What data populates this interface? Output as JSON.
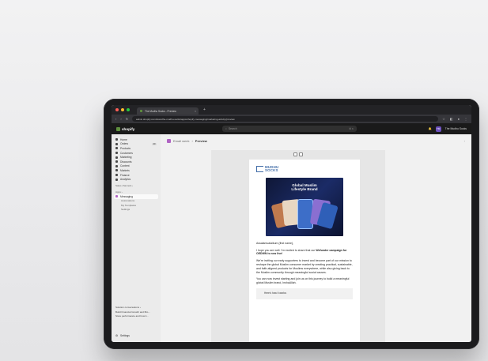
{
  "browser": {
    "tab_title": "The Mudhu Socks - Preview",
    "tab_close": "×",
    "new_tab": "+",
    "url": "admin.shopify.com/store/the-mudhu-socks/apps/shopify-messaging/marketing-activity/preview",
    "nav_back": "‹",
    "nav_forward": "›",
    "nav_reload": "↻"
  },
  "topbar": {
    "brand": "shopify",
    "search_placeholder": "Search",
    "search_shortcut": "⌘ K",
    "store_initials": "TM",
    "store_name": "The Mudhu Socks"
  },
  "sidebar": {
    "items": [
      {
        "label": "Home"
      },
      {
        "label": "Orders",
        "count": "20"
      },
      {
        "label": "Products"
      },
      {
        "label": "Customers"
      },
      {
        "label": "Marketing"
      },
      {
        "label": "Discounts"
      },
      {
        "label": "Content"
      },
      {
        "label": "Markets"
      },
      {
        "label": "Finance"
      },
      {
        "label": "Analytics"
      }
    ],
    "sales_channels": "Sales channels ›",
    "apps": "Apps ›",
    "active_app": "Messaging",
    "subitems": [
      "Automations",
      "My Templates",
      "Settings"
    ],
    "bottom": [
      "Solution conversations ›",
      "Build Financial Growth and Bro...",
      "Store performance and how it..."
    ],
    "settings": "Settings"
  },
  "main": {
    "breadcrumb_parent": "Email week",
    "breadcrumb_sep": "›",
    "breadcrumb_current": "Preview",
    "right_icon": "›"
  },
  "email": {
    "brand_line1": "MUDHU",
    "brand_line2": "SOCKS",
    "hero_title_line1": "Global Muslim",
    "hero_title_line2": "Lifestyle Brand",
    "greeting": "Assalamualaikum {first name},",
    "p1_start": "I hope you are well. I'm excited to share that our ",
    "p1_bold": "Wefunder campaign for OEDWN is now live!",
    "p2": "We're inviting our early supporters to invest and become part of our mission to reshape the global Muslim consumer market by creating practical, sustainable, and faith-aligned products for Muslims everywhere, while also giving back to the Muslim community through meaningful social causes.",
    "p3": "You can now invest starting and join us on this journey to build a meaningful global Muslim brand, InshaAllah.",
    "footer_label": "Here's how it works:"
  },
  "colors": {
    "device": "#1b1b1d",
    "shop_topbar": "#1a1a1a",
    "brand_blue": "#3e6aa6",
    "hero_bg": "#1b2b66",
    "messaging_icon": "#b064c4"
  }
}
